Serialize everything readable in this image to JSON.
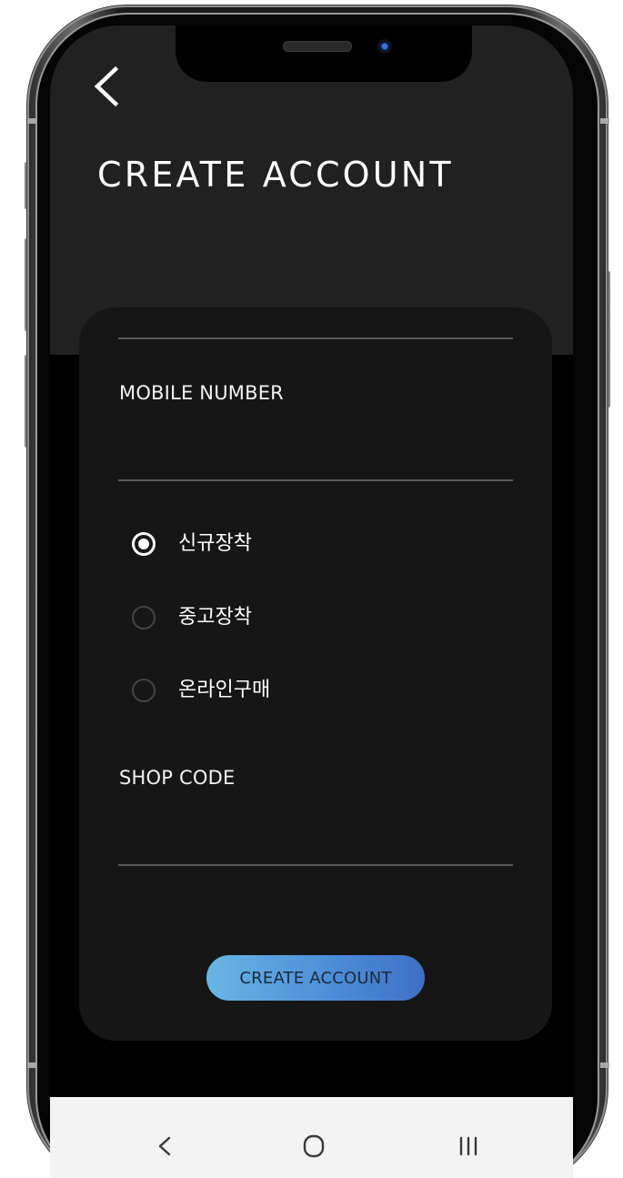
{
  "screen": {
    "title": "CREATE ACCOUNT"
  },
  "form": {
    "mobile_label": "MOBILE NUMBER",
    "mobile_value": "",
    "radio_options": [
      {
        "label": "신규장착",
        "checked": true
      },
      {
        "label": "중고장착",
        "checked": false
      },
      {
        "label": "온라인구매",
        "checked": false
      }
    ],
    "shop_code_label": "SHOP CODE",
    "shop_code_value": "",
    "submit_label": "CREATE ACCOUNT"
  },
  "icons": {
    "back": "chevron-left-icon",
    "nav_back": "nav-back-icon",
    "nav_home": "nav-home-icon",
    "nav_recents": "nav-recents-icon"
  },
  "colors": {
    "header_bg": "#212121",
    "card_bg": "#161616",
    "screen_bg": "#000000",
    "button_gradient_start": "#69b6e6",
    "button_gradient_end": "#3f6fc4",
    "nav_bar_bg": "#f3f3f3"
  }
}
